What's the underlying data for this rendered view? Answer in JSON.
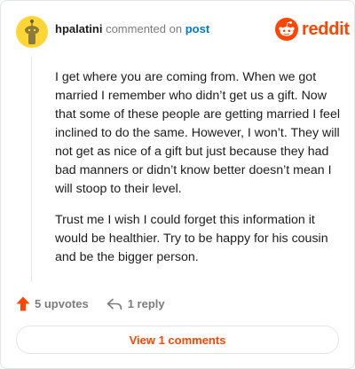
{
  "comment": {
    "author": "hpalatini",
    "action_text": "commented on",
    "post_link": "post",
    "paragraphs": [
      "I get where you are coming from. When we got married I remember who didn’t get us a gift. Now that some of these people are getting married I feel inclined to do the same. However, I won’t. They will not get as nice of a gift but just because they had bad manners or didn’t know better doesn’t mean I will stoop to their level.",
      "Trust me I wish I could forget this information it would be healthier. Try to be happy for his cousin and be the bigger person."
    ]
  },
  "brand": {
    "name": "reddit",
    "color": "#ff4500",
    "icon": "reddit-snoo-icon"
  },
  "footer": {
    "upvotes_label": "5 upvotes",
    "upvote_icon": "upvote-arrow-icon",
    "replies_label": "1 reply",
    "reply_icon": "reply-arrow-icon"
  },
  "view_comments_label": "View 1 comments",
  "colors": {
    "accent": "#ff4500",
    "link": "#0079d3",
    "text": "#1c1c1c",
    "muted": "#7c7c7c",
    "border": "#e3e6e8",
    "avatar_bg": "#ffd635"
  }
}
